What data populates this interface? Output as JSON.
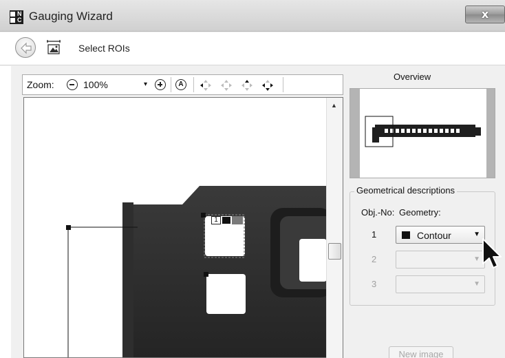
{
  "window": {
    "title": "Gauging Wizard",
    "app_icon_letters": [
      "N",
      "C"
    ],
    "close_glyph": "x"
  },
  "step": {
    "title": "Select ROIs",
    "back_icon": "back-arrow-icon",
    "step_icon": "roi-select-icon"
  },
  "toolbar": {
    "zoom_label": "Zoom:",
    "zoom_value": "100%",
    "zoom_dropdown_glyph": "▾",
    "auto_zoom_glyph": "A",
    "icons": [
      "zoom-out-icon",
      "zoom-in-icon",
      "auto-zoom-icon",
      "pan-left-icon",
      "pan-all-icon",
      "pan-up-icon",
      "pan-down-icon"
    ]
  },
  "viewport": {
    "roi_label": "1",
    "scroll_up_glyph": "▲"
  },
  "overview": {
    "title": "Overview"
  },
  "geometry": {
    "group_title": "Geometrical descriptions",
    "col_objno": "Obj.-No:",
    "col_geometry": "Geometry:",
    "rows": [
      {
        "no": "1",
        "value": "Contour",
        "enabled": true
      },
      {
        "no": "2",
        "value": "",
        "enabled": false
      },
      {
        "no": "3",
        "value": "",
        "enabled": false
      }
    ],
    "dropdown_glyph": "▼"
  },
  "buttons": {
    "new_image": "New image"
  },
  "colors": {
    "titlebar": "#d8d8d8",
    "workpiece": "#2a2a2a",
    "window_bg": "#f0f0f0"
  }
}
